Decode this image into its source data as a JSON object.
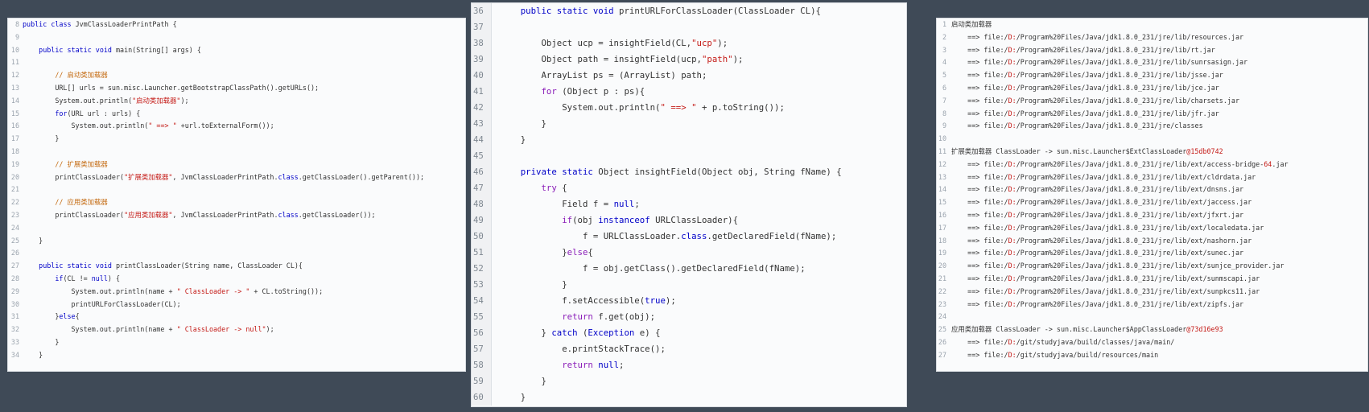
{
  "left_panel": {
    "lines": [
      {
        "n": "8",
        "code": "public class JvmClassLoaderPrintPath {"
      },
      {
        "n": "9",
        "code": ""
      },
      {
        "n": "10",
        "code": "    public static void main(String[] args) {"
      },
      {
        "n": "11",
        "code": ""
      },
      {
        "n": "12",
        "code": "        // 启动类加载器"
      },
      {
        "n": "13",
        "code": "        URL[] urls = sun.misc.Launcher.getBootstrapClassPath().getURLs();"
      },
      {
        "n": "14",
        "code": "        System.out.println(\"启动类加载器\");"
      },
      {
        "n": "15",
        "code": "        for(URL url : urls) {"
      },
      {
        "n": "16",
        "code": "            System.out.println(\" ==> \" +url.toExternalForm());"
      },
      {
        "n": "17",
        "code": "        }"
      },
      {
        "n": "18",
        "code": ""
      },
      {
        "n": "19",
        "code": "        // 扩展类加载器"
      },
      {
        "n": "20",
        "code": "        printClassLoader(\"扩展类加载器\", JvmClassLoaderPrintPath.class.getClassLoader().getParent());"
      },
      {
        "n": "21",
        "code": ""
      },
      {
        "n": "22",
        "code": "        // 应用类加载器"
      },
      {
        "n": "23",
        "code": "        printClassLoader(\"应用类加载器\", JvmClassLoaderPrintPath.class.getClassLoader());"
      },
      {
        "n": "24",
        "code": ""
      },
      {
        "n": "25",
        "code": "    }"
      },
      {
        "n": "26",
        "code": ""
      },
      {
        "n": "27",
        "code": "    public static void printClassLoader(String name, ClassLoader CL){"
      },
      {
        "n": "28",
        "code": "        if(CL != null) {"
      },
      {
        "n": "29",
        "code": "            System.out.println(name + \" ClassLoader -> \" + CL.toString());"
      },
      {
        "n": "30",
        "code": "            printURLForClassLoader(CL);"
      },
      {
        "n": "31",
        "code": "        }else{"
      },
      {
        "n": "32",
        "code": "            System.out.println(name + \" ClassLoader -> null\");"
      },
      {
        "n": "33",
        "code": "        }"
      },
      {
        "n": "34",
        "code": "    }"
      }
    ]
  },
  "middle_panel": {
    "lines": [
      {
        "n": "36",
        "code": "    public static void printURLForClassLoader(ClassLoader CL){"
      },
      {
        "n": "37",
        "code": ""
      },
      {
        "n": "38",
        "code": "        Object ucp = insightField(CL,\"ucp\");"
      },
      {
        "n": "39",
        "code": "        Object path = insightField(ucp,\"path\");"
      },
      {
        "n": "40",
        "code": "        ArrayList ps = (ArrayList) path;"
      },
      {
        "n": "41",
        "code": "        for (Object p : ps){"
      },
      {
        "n": "42",
        "code": "            System.out.println(\" ==> \" + p.toString());"
      },
      {
        "n": "43",
        "code": "        }"
      },
      {
        "n": "44",
        "code": "    }"
      },
      {
        "n": "45",
        "code": ""
      },
      {
        "n": "46",
        "code": "    private static Object insightField(Object obj, String fName) {"
      },
      {
        "n": "47",
        "code": "        try {"
      },
      {
        "n": "48",
        "code": "            Field f = null;"
      },
      {
        "n": "49",
        "code": "            if(obj instanceof URLClassLoader){"
      },
      {
        "n": "50",
        "code": "                f = URLClassLoader.class.getDeclaredField(fName);"
      },
      {
        "n": "51",
        "code": "            }else{"
      },
      {
        "n": "52",
        "code": "                f = obj.getClass().getDeclaredField(fName);"
      },
      {
        "n": "53",
        "code": "            }"
      },
      {
        "n": "54",
        "code": "            f.setAccessible(true);"
      },
      {
        "n": "55",
        "code": "            return f.get(obj);"
      },
      {
        "n": "56",
        "code": "        } catch (Exception e) {"
      },
      {
        "n": "57",
        "code": "            e.printStackTrace();"
      },
      {
        "n": "58",
        "code": "            return null;"
      },
      {
        "n": "59",
        "code": "        }"
      },
      {
        "n": "60",
        "code": "    }"
      }
    ]
  },
  "right_panel": {
    "lines": [
      {
        "n": "1",
        "code": "启动类加载器"
      },
      {
        "n": "2",
        "code": "    ==> file:/D:/Program%20Files/Java/jdk1.8.0_231/jre/lib/resources.jar"
      },
      {
        "n": "3",
        "code": "    ==> file:/D:/Program%20Files/Java/jdk1.8.0_231/jre/lib/rt.jar"
      },
      {
        "n": "4",
        "code": "    ==> file:/D:/Program%20Files/Java/jdk1.8.0_231/jre/lib/sunrsasign.jar"
      },
      {
        "n": "5",
        "code": "    ==> file:/D:/Program%20Files/Java/jdk1.8.0_231/jre/lib/jsse.jar"
      },
      {
        "n": "6",
        "code": "    ==> file:/D:/Program%20Files/Java/jdk1.8.0_231/jre/lib/jce.jar"
      },
      {
        "n": "7",
        "code": "    ==> file:/D:/Program%20Files/Java/jdk1.8.0_231/jre/lib/charsets.jar"
      },
      {
        "n": "8",
        "code": "    ==> file:/D:/Program%20Files/Java/jdk1.8.0_231/jre/lib/jfr.jar"
      },
      {
        "n": "9",
        "code": "    ==> file:/D:/Program%20Files/Java/jdk1.8.0_231/jre/classes"
      },
      {
        "n": "10",
        "code": ""
      },
      {
        "n": "11",
        "code": "扩展类加载器 ClassLoader -> sun.misc.Launcher$ExtClassLoader@15db0742"
      },
      {
        "n": "12",
        "code": "    ==> file:/D:/Program%20Files/Java/jdk1.8.0_231/jre/lib/ext/access-bridge-64.jar"
      },
      {
        "n": "13",
        "code": "    ==> file:/D:/Program%20Files/Java/jdk1.8.0_231/jre/lib/ext/cldrdata.jar"
      },
      {
        "n": "14",
        "code": "    ==> file:/D:/Program%20Files/Java/jdk1.8.0_231/jre/lib/ext/dnsns.jar"
      },
      {
        "n": "15",
        "code": "    ==> file:/D:/Program%20Files/Java/jdk1.8.0_231/jre/lib/ext/jaccess.jar"
      },
      {
        "n": "16",
        "code": "    ==> file:/D:/Program%20Files/Java/jdk1.8.0_231/jre/lib/ext/jfxrt.jar"
      },
      {
        "n": "17",
        "code": "    ==> file:/D:/Program%20Files/Java/jdk1.8.0_231/jre/lib/ext/localedata.jar"
      },
      {
        "n": "18",
        "code": "    ==> file:/D:/Program%20Files/Java/jdk1.8.0_231/jre/lib/ext/nashorn.jar"
      },
      {
        "n": "19",
        "code": "    ==> file:/D:/Program%20Files/Java/jdk1.8.0_231/jre/lib/ext/sunec.jar"
      },
      {
        "n": "20",
        "code": "    ==> file:/D:/Program%20Files/Java/jdk1.8.0_231/jre/lib/ext/sunjce_provider.jar"
      },
      {
        "n": "21",
        "code": "    ==> file:/D:/Program%20Files/Java/jdk1.8.0_231/jre/lib/ext/sunmscapi.jar"
      },
      {
        "n": "22",
        "code": "    ==> file:/D:/Program%20Files/Java/jdk1.8.0_231/jre/lib/ext/sunpkcs11.jar"
      },
      {
        "n": "23",
        "code": "    ==> file:/D:/Program%20Files/Java/jdk1.8.0_231/jre/lib/ext/zipfs.jar"
      },
      {
        "n": "24",
        "code": ""
      },
      {
        "n": "25",
        "code": "应用类加载器 ClassLoader -> sun.misc.Launcher$AppClassLoader@73d16e93"
      },
      {
        "n": "26",
        "code": "    ==> file:/D:/git/studyjava/build/classes/java/main/"
      },
      {
        "n": "27",
        "code": "    ==> file:/D:/git/studyjava/build/resources/main"
      }
    ]
  },
  "colors": {
    "background": "#3f4a57",
    "panel": "#fafbfc",
    "keyword": "#0000c8",
    "string": "#c41a16",
    "comment": "#c46a10"
  }
}
